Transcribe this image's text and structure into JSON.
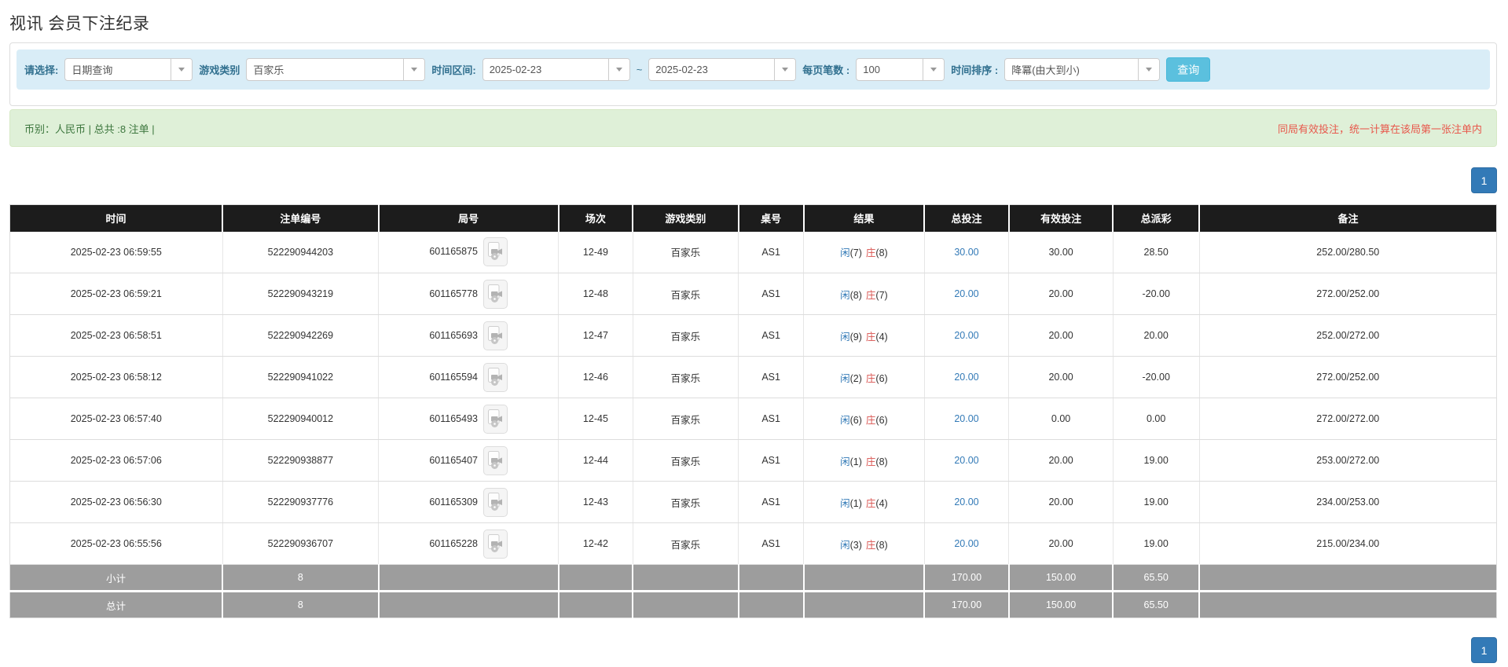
{
  "page": {
    "title": "视讯 会员下注纪录"
  },
  "filters": {
    "select_label": "请选择:",
    "select_value": "日期查询",
    "game_label": "游戏类别",
    "game_value": "百家乐",
    "range_label": "时间区间:",
    "date_from": "2025-02-23",
    "range_sep": "~",
    "date_to": "2025-02-23",
    "per_page_label": "每页笔数 :",
    "per_page_value": "100",
    "sort_label": "时间排序 :",
    "sort_value": "降冪(由大到小)",
    "search_button": "查询"
  },
  "summary": {
    "left": "币别：人民币 | 总共 :8 注单 |",
    "right_notice": "同局有效投注，统一计算在该局第一张注单内"
  },
  "pagination": {
    "page": "1"
  },
  "table": {
    "headers": {
      "time": "时间",
      "bet_id": "注单编号",
      "round": "局号",
      "session": "场次",
      "game": "游戏类别",
      "table_no": "桌号",
      "result": "结果",
      "total_bet": "总投注",
      "valid_bet": "有效投注",
      "payout": "总派彩",
      "remark": "备注"
    },
    "rows": [
      {
        "time": "2025-02-23 06:59:55",
        "bet_id": "522290944203",
        "round_id": "601165875",
        "session": "12-49",
        "game": "百家乐",
        "table_no": "AS1",
        "player": "闲",
        "player_pts": "(7)",
        "banker": "庄",
        "banker_pts": "(8)",
        "total_bet": "30.00",
        "valid_bet": "30.00",
        "payout": "28.50",
        "payout_negative": false,
        "remark": "252.00/280.50"
      },
      {
        "time": "2025-02-23 06:59:21",
        "bet_id": "522290943219",
        "round_id": "601165778",
        "session": "12-48",
        "game": "百家乐",
        "table_no": "AS1",
        "player": "闲",
        "player_pts": "(8)",
        "banker": "庄",
        "banker_pts": "(7)",
        "total_bet": "20.00",
        "valid_bet": "20.00",
        "payout": "-20.00",
        "payout_negative": true,
        "remark": "272.00/252.00"
      },
      {
        "time": "2025-02-23 06:58:51",
        "bet_id": "522290942269",
        "round_id": "601165693",
        "session": "12-47",
        "game": "百家乐",
        "table_no": "AS1",
        "player": "闲",
        "player_pts": "(9)",
        "banker": "庄",
        "banker_pts": "(4)",
        "total_bet": "20.00",
        "valid_bet": "20.00",
        "payout": "20.00",
        "payout_negative": false,
        "remark": "252.00/272.00"
      },
      {
        "time": "2025-02-23 06:58:12",
        "bet_id": "522290941022",
        "round_id": "601165594",
        "session": "12-46",
        "game": "百家乐",
        "table_no": "AS1",
        "player": "闲",
        "player_pts": "(2)",
        "banker": "庄",
        "banker_pts": "(6)",
        "total_bet": "20.00",
        "valid_bet": "20.00",
        "payout": "-20.00",
        "payout_negative": true,
        "remark": "272.00/252.00"
      },
      {
        "time": "2025-02-23 06:57:40",
        "bet_id": "522290940012",
        "round_id": "601165493",
        "session": "12-45",
        "game": "百家乐",
        "table_no": "AS1",
        "player": "闲",
        "player_pts": "(6)",
        "banker": "庄",
        "banker_pts": "(6)",
        "total_bet": "20.00",
        "valid_bet": "0.00",
        "payout": "0.00",
        "payout_negative": false,
        "remark": "272.00/272.00"
      },
      {
        "time": "2025-02-23 06:57:06",
        "bet_id": "522290938877",
        "round_id": "601165407",
        "session": "12-44",
        "game": "百家乐",
        "table_no": "AS1",
        "player": "闲",
        "player_pts": "(1)",
        "banker": "庄",
        "banker_pts": "(8)",
        "total_bet": "20.00",
        "valid_bet": "20.00",
        "payout": "19.00",
        "payout_negative": false,
        "remark": "253.00/272.00"
      },
      {
        "time": "2025-02-23 06:56:30",
        "bet_id": "522290937776",
        "round_id": "601165309",
        "session": "12-43",
        "game": "百家乐",
        "table_no": "AS1",
        "player": "闲",
        "player_pts": "(1)",
        "banker": "庄",
        "banker_pts": "(4)",
        "total_bet": "20.00",
        "valid_bet": "20.00",
        "payout": "19.00",
        "payout_negative": false,
        "remark": "234.00/253.00"
      },
      {
        "time": "2025-02-23 06:55:56",
        "bet_id": "522290936707",
        "round_id": "601165228",
        "session": "12-42",
        "game": "百家乐",
        "table_no": "AS1",
        "player": "闲",
        "player_pts": "(3)",
        "banker": "庄",
        "banker_pts": "(8)",
        "total_bet": "20.00",
        "valid_bet": "20.00",
        "payout": "19.00",
        "payout_negative": false,
        "remark": "215.00/234.00"
      }
    ],
    "subtotal": {
      "label": "小计",
      "count": "8",
      "total_bet": "170.00",
      "valid_bet": "150.00",
      "payout": "65.50"
    },
    "grand_total": {
      "label": "总计",
      "count": "8",
      "total_bet": "170.00",
      "valid_bet": "150.00",
      "payout": "65.50"
    }
  },
  "icons": {
    "video_replay": "video-replay-icon",
    "chevron_down": "chevron-down-icon"
  },
  "colors": {
    "filter_bar_bg": "#d9edf7",
    "filter_label": "#31708f",
    "search_button_bg": "#5bc0de",
    "summary_bg": "#dff0d8",
    "summary_text": "#3c763d",
    "notice_red": "#e8584c",
    "header_bg": "#1c1c1c",
    "totals_bg": "#9d9d9d",
    "link_blue": "#337ab7",
    "player_blue": "#337ab7",
    "banker_red": "#d9534f",
    "negative_red": "#e63c35",
    "pagination_bg": "#337ab7"
  }
}
